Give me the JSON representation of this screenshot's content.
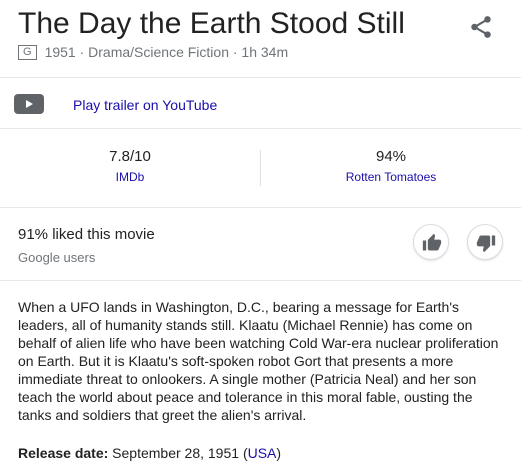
{
  "title": "The Day the Earth Stood Still",
  "meta": {
    "rating": "G",
    "info": "1951 · Drama/Science Fiction · 1h 34m"
  },
  "trailer": {
    "label": "Play trailer on YouTube"
  },
  "scores": [
    {
      "value": "7.8/10",
      "source": "IMDb"
    },
    {
      "value": "94%",
      "source": "Rotten Tomatoes"
    }
  ],
  "audience": {
    "liked": "91% liked this movie",
    "source": "Google users"
  },
  "description": "When a UFO lands in Washington, D.C., bearing a message for Earth's leaders, all of humanity stands still. Klaatu (Michael Rennie) has come on behalf of alien life who have been watching Cold War-era nuclear proliferation on Earth. But it is Klaatu's soft-spoken robot Gort that presents a more immediate threat to onlookers. A single mother (Patricia Neal) and her son teach the world about peace and tolerance in this moral fable, ousting the tanks and soldiers that greet the alien's arrival.",
  "release": {
    "label": "Release date:",
    "date": "September 28, 1951",
    "open_paren": "(",
    "region": "USA",
    "close_paren": ")"
  },
  "icons": {
    "share": "share-icon",
    "youtube": "youtube-play-icon",
    "thumbs_up": "thumbs-up-icon",
    "thumbs_down": "thumbs-down-icon"
  },
  "colors": {
    "link": "#1a0dab",
    "secondary_text": "#70757a",
    "icon_gray": "#5f6368"
  }
}
